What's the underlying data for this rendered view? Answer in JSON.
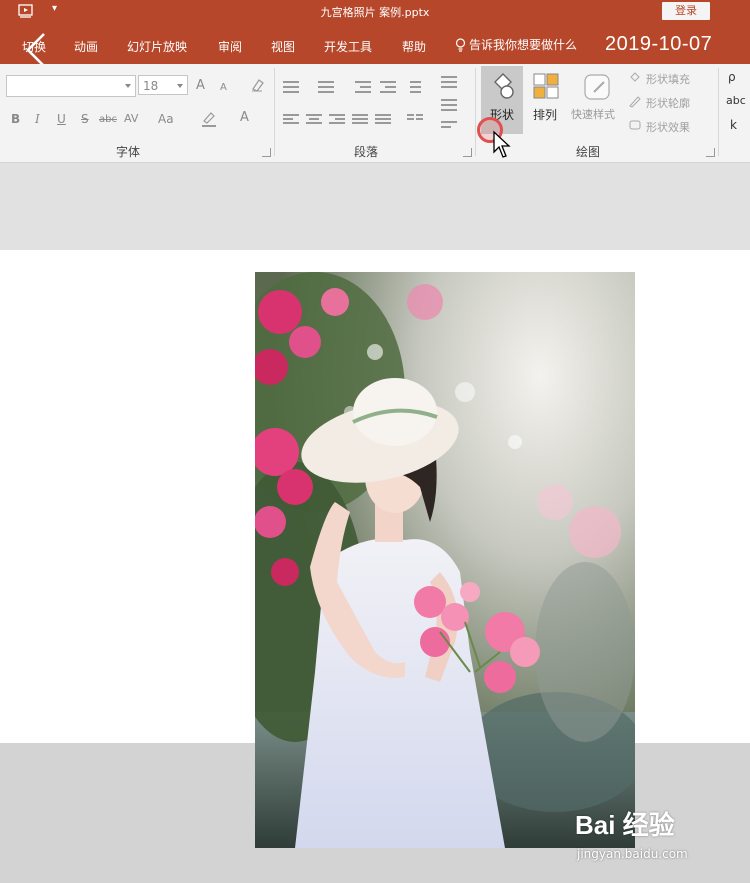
{
  "window": {
    "document_title": "九宫格照片 案例.pptx",
    "login_label": "登录"
  },
  "tabs": [
    {
      "label": "切换"
    },
    {
      "label": "动画"
    },
    {
      "label": "幻灯片放映"
    },
    {
      "label": "审阅"
    },
    {
      "label": "视图"
    },
    {
      "label": "开发工具"
    },
    {
      "label": "帮助"
    }
  ],
  "tell_me": "告诉我你想要做什么",
  "date_overlay": "2019-10-07",
  "ribbon": {
    "font_group": {
      "label": "字体",
      "font_name": "",
      "font_size": "18",
      "buttons": [
        "A",
        "A",
        "B",
        "I",
        "U",
        "S",
        "abc",
        "AV",
        "Aa",
        "A"
      ]
    },
    "paragraph_group": {
      "label": "段落"
    },
    "drawing_group": {
      "label": "绘图",
      "shape_label": "形状",
      "arrange_label": "排列",
      "quick_styles_label": "快速样式",
      "shape_fill_label": "形状填充",
      "shape_outline_label": "形状轮廓",
      "shape_effects_label": "形状效果"
    },
    "edit_group": {
      "partial_labels": [
        "ρ",
        "abc",
        "k"
      ]
    }
  },
  "watermark": {
    "logo_text": "Bai 经验",
    "url": "jingyan.baidu.com"
  },
  "colors": {
    "brand_red": "#b7472a",
    "ribbon_bg": "#f3f3f3",
    "pressed_button": "#c9c9c9",
    "click_ring": "#e05050"
  }
}
